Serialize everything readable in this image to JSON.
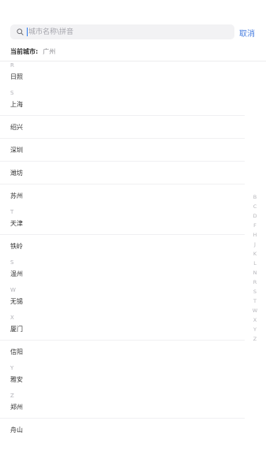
{
  "search": {
    "placeholder": "城市名称\\拼音",
    "value": "",
    "cancel_label": "取消"
  },
  "current_city": {
    "label": "当前城市:",
    "value": "广州"
  },
  "groups": [
    {
      "letter": "R",
      "cities": [
        "日照"
      ]
    },
    {
      "letter": "S",
      "cities": [
        "上海",
        "绍兴",
        "深圳",
        "潍坊",
        "苏州"
      ]
    },
    {
      "letter": "T",
      "cities": [
        "天津",
        "铁岭"
      ]
    },
    {
      "letter": "S",
      "cities": [
        "温州"
      ]
    },
    {
      "letter": "W",
      "cities": [
        "无锡"
      ]
    },
    {
      "letter": "X",
      "cities": [
        "厦门",
        "信阳"
      ]
    },
    {
      "letter": "Y",
      "cities": [
        "雅安"
      ]
    },
    {
      "letter": "Z",
      "cities": [
        "郑州",
        "舟山"
      ]
    }
  ],
  "index_letters": [
    "B",
    "C",
    "D",
    "F",
    "H",
    "J",
    "K",
    "L",
    "N",
    "R",
    "S",
    "T",
    "W",
    "X",
    "Y",
    "Z"
  ],
  "colors": {
    "accent": "#4a7fe0",
    "text": "#333333",
    "muted": "#b2b2b8",
    "search_bg": "#f2f2f4"
  }
}
